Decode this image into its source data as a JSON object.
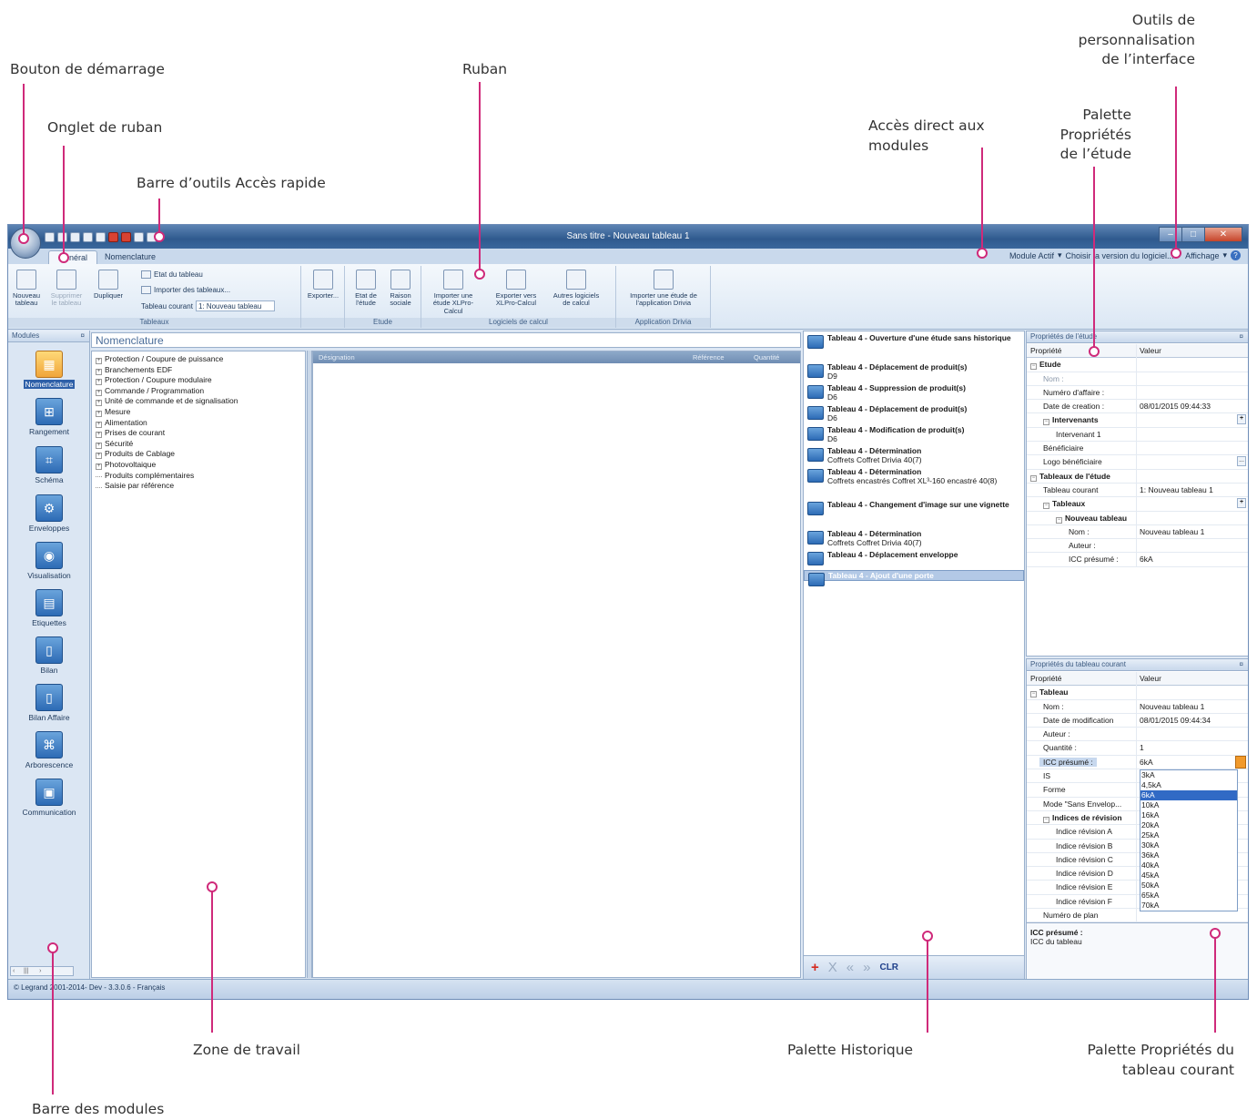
{
  "annotations": {
    "bouton_demarrage": "Bouton de démarrage",
    "onglet_ruban": "Onglet de ruban",
    "barre_acces_rapide": "Barre d’outils Accès rapide",
    "ruban": "Ruban",
    "acces_direct_1": "Accès direct aux",
    "acces_direct_2": "modules",
    "outils_perso_1": "Outils de",
    "outils_perso_2": "personnalisation",
    "outils_perso_3": "de l’interface",
    "palette_etude_1": "Palette",
    "palette_etude_2": "Propriétés",
    "palette_etude_3": "de l’étude",
    "zone_travail": "Zone de travail",
    "palette_historique": "Palette  Historique",
    "palette_tableau_1": "Palette Propriétés du",
    "palette_tableau_2": "tableau courant",
    "barre_modules": "Barre des modules"
  },
  "window": {
    "title": "Sans titre - Nouveau tableau 1",
    "tabs": [
      "Général",
      "Nomenclature"
    ],
    "right_links": {
      "module_actif": "Module Actif",
      "choisir_version": "Choisir la version du logiciel...",
      "affichage": "Affichage"
    },
    "status": "© Legrand 2001-2014- Dev - 3.3.0.6 - Français"
  },
  "ribbon": {
    "tableaux": {
      "label": "Tableaux",
      "nouveau": "Nouveau tableau",
      "supprimer": "Supprimer le tableau",
      "dupliquer": "Dupliquer",
      "etat": "Etat du tableau",
      "importer": "Importer des tableaux...",
      "courant_label": "Tableau courant",
      "courant_value": "1: Nouveau tableau"
    },
    "exporter": "Exporter...",
    "etude": {
      "label": "Etude",
      "etat": "Etat de l'étude",
      "raison": "Raison sociale"
    },
    "logiciels": {
      "label": "Logiciels de calcul",
      "importer": "Importer une étude XLPro-Calcul",
      "exporter": "Exporter vers XLPro-Calcul",
      "autres": "Autres logiciels de calcul"
    },
    "drivia": {
      "label": "Application Drivia",
      "importer": "Importer une étude de l'application Drivia"
    }
  },
  "modules": {
    "title": "Modules",
    "items": [
      "Nomenclature",
      "Rangement",
      "Schéma",
      "Enveloppes",
      "Visualisation",
      "Etiquettes",
      "Bilan",
      "Bilan Affaire",
      "Arborescence",
      "Communication"
    ]
  },
  "work": {
    "title": "Nomenclature",
    "tree": [
      {
        "label": "Protection / Coupure de puissance",
        "expandable": true
      },
      {
        "label": "Branchements EDF",
        "expandable": true
      },
      {
        "label": "Protection / Coupure modulaire",
        "expandable": true
      },
      {
        "label": "Commande / Programmation",
        "expandable": true
      },
      {
        "label": "Unité de commande et de signalisation",
        "expandable": true
      },
      {
        "label": "Mesure",
        "expandable": true
      },
      {
        "label": "Alimentation",
        "expandable": true
      },
      {
        "label": "Prises de courant",
        "expandable": true
      },
      {
        "label": "Sécurité",
        "expandable": true
      },
      {
        "label": "Produits de Cablage",
        "expandable": true
      },
      {
        "label": "Photovoltaique",
        "expandable": true
      },
      {
        "label": "Produits complémentaires",
        "expandable": false
      },
      {
        "label": "Saisie par référence",
        "expandable": false
      }
    ],
    "grid_headers": {
      "designation": "Désignation",
      "reference": "Référence",
      "quantite": "Quantité"
    }
  },
  "history": {
    "items": [
      {
        "title": "Tableau 4 - Ouverture d'une étude sans historique",
        "sub": ""
      },
      {
        "title": "Tableau 4 - Déplacement de produit(s)",
        "sub": "D9"
      },
      {
        "title": "Tableau 4 - Suppression de produit(s)",
        "sub": "D6"
      },
      {
        "title": "Tableau 4 - Déplacement de produit(s)",
        "sub": "D6"
      },
      {
        "title": "Tableau 4 - Modification de produit(s)",
        "sub": "D6"
      },
      {
        "title": "Tableau 4 - Détermination",
        "sub": "Coffrets Coffret Drivia 40(7)"
      },
      {
        "title": "Tableau 4 - Détermination",
        "sub": "Coffrets encastrés Coffret XL³-160 encastré 40(8)"
      },
      {
        "title": "Tableau 4 - Changement d'image sur une vignette",
        "sub": ""
      },
      {
        "title": "Tableau 4 - Détermination",
        "sub": "Coffrets Coffret Drivia 40(7)"
      },
      {
        "title": "Tableau 4 - Déplacement enveloppe",
        "sub": ""
      },
      {
        "title": "Tableau 4 - Ajout d'une porte",
        "sub": ""
      }
    ],
    "toolbar": {
      "add": "+",
      "remove": "X",
      "first": "«",
      "last": "»",
      "clr": "CLR"
    }
  },
  "props_etude": {
    "title": "Propriétés de l'étude",
    "col_prop": "Propriété",
    "col_val": "Valeur",
    "rows": [
      {
        "name": "Etude",
        "value": "",
        "kind": "cat",
        "indent": 0
      },
      {
        "name": "Nom :",
        "value": "",
        "kind": "dim",
        "indent": 1
      },
      {
        "name": "Numéro d'affaire :",
        "value": "",
        "kind": "row",
        "indent": 1
      },
      {
        "name": "Date de creation :",
        "value": "08/01/2015 09:44:33",
        "kind": "row",
        "indent": 1
      },
      {
        "name": "Intervenants",
        "value": "",
        "kind": "cat",
        "indent": 1,
        "btn": "+"
      },
      {
        "name": "Intervenant 1",
        "value": "",
        "kind": "row",
        "indent": 2
      },
      {
        "name": "Bénéficiaire",
        "value": "",
        "kind": "row",
        "indent": 1
      },
      {
        "name": "Logo bénéficiaire",
        "value": "",
        "kind": "row",
        "indent": 1,
        "btn": "..."
      },
      {
        "name": "Tableaux de l'étude",
        "value": "",
        "kind": "cat",
        "indent": 0
      },
      {
        "name": "Tableau courant",
        "value": "1: Nouveau tableau 1",
        "kind": "row",
        "indent": 1
      },
      {
        "name": "Tableaux",
        "value": "",
        "kind": "cat",
        "indent": 1,
        "btn": "+"
      },
      {
        "name": "Nouveau tableau",
        "value": "",
        "kind": "cat",
        "indent": 2
      },
      {
        "name": "Nom :",
        "value": "Nouveau tableau 1",
        "kind": "row",
        "indent": 3
      },
      {
        "name": "Auteur :",
        "value": "",
        "kind": "row",
        "indent": 3
      },
      {
        "name": "ICC présumé :",
        "value": "6kA",
        "kind": "row",
        "indent": 3
      }
    ]
  },
  "props_tableau": {
    "title": "Propriétés du tableau courant",
    "col_prop": "Propriété",
    "col_val": "Valeur",
    "rows": [
      {
        "name": "Tableau",
        "value": "",
        "kind": "cat",
        "indent": 0
      },
      {
        "name": "Nom :",
        "value": "Nouveau tableau 1",
        "kind": "row",
        "indent": 1
      },
      {
        "name": "Date de modification",
        "value": "08/01/2015 09:44:34",
        "kind": "row",
        "indent": 1
      },
      {
        "name": "Auteur :",
        "value": "",
        "kind": "row",
        "indent": 1
      },
      {
        "name": "Quantité :",
        "value": "1",
        "kind": "row",
        "indent": 1
      },
      {
        "name": "ICC présumé :",
        "value": "6kA",
        "kind": "sel",
        "indent": 1
      },
      {
        "name": "IS",
        "value": "",
        "kind": "row",
        "indent": 1
      },
      {
        "name": "Forme",
        "value": "",
        "kind": "row",
        "indent": 1
      },
      {
        "name": "Mode \"Sans Envelop...",
        "value": "",
        "kind": "row",
        "indent": 1
      },
      {
        "name": "Indices de révision",
        "value": "",
        "kind": "cat",
        "indent": 1
      },
      {
        "name": "Indice révision A",
        "value": "",
        "kind": "row",
        "indent": 2
      },
      {
        "name": "Indice révision B",
        "value": "",
        "kind": "row",
        "indent": 2
      },
      {
        "name": "Indice révision C",
        "value": "",
        "kind": "row",
        "indent": 2
      },
      {
        "name": "Indice révision D",
        "value": "",
        "kind": "row",
        "indent": 2
      },
      {
        "name": "Indice révision E",
        "value": "",
        "kind": "row",
        "indent": 2
      },
      {
        "name": "Indice révision F",
        "value": "",
        "kind": "row",
        "indent": 2
      },
      {
        "name": "Numéro de plan",
        "value": "",
        "kind": "row",
        "indent": 1
      }
    ],
    "dropdown": [
      "3kA",
      "4,5kA",
      "6kA",
      "10kA",
      "16kA",
      "20kA",
      "25kA",
      "30kA",
      "36kA",
      "40kA",
      "45kA",
      "50kA",
      "65kA",
      "70kA"
    ],
    "dropdown_selected": "6kA",
    "desc_title": "ICC présumé :",
    "desc_text": "ICC du tableau"
  },
  "colors": {
    "accent": "#cf2a7a",
    "titlebar": "#2f5a8e",
    "selection": "#316ac5"
  }
}
